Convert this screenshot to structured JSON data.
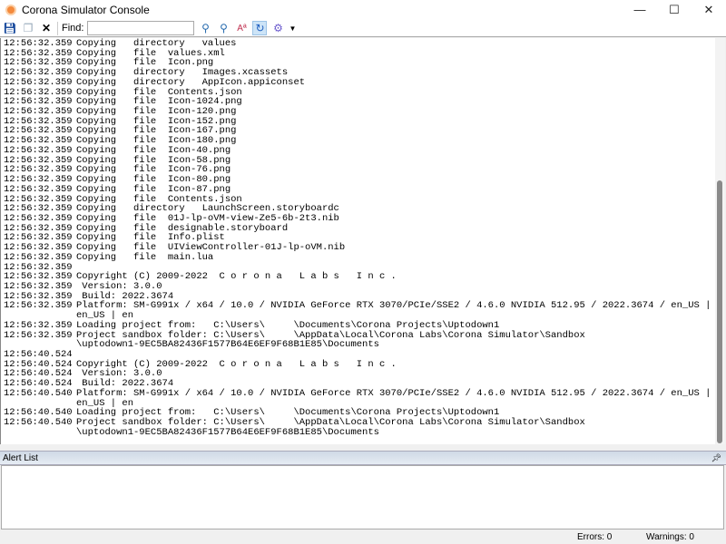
{
  "window": {
    "title": "Corona Simulator Console",
    "minimize": "—",
    "maximize": "☐",
    "close": "✕"
  },
  "toolbar": {
    "find_label": "Find:",
    "find_value": "",
    "icons": [
      "save-icon",
      "copy-icon",
      "clear-icon",
      "find-next-icon",
      "find-previous-icon",
      "match-case-icon",
      "wrap-icon",
      "settings-icon"
    ]
  },
  "console": {
    "lines": [
      [
        "12:56:32.359",
        "Copying   directory   values"
      ],
      [
        "12:56:32.359",
        "Copying   file  values.xml"
      ],
      [
        "12:56:32.359",
        "Copying   file  Icon.png"
      ],
      [
        "12:56:32.359",
        "Copying   directory   Images.xcassets"
      ],
      [
        "12:56:32.359",
        "Copying   directory   AppIcon.appiconset"
      ],
      [
        "12:56:32.359",
        "Copying   file  Contents.json"
      ],
      [
        "12:56:32.359",
        "Copying   file  Icon-1024.png"
      ],
      [
        "12:56:32.359",
        "Copying   file  Icon-120.png"
      ],
      [
        "12:56:32.359",
        "Copying   file  Icon-152.png"
      ],
      [
        "12:56:32.359",
        "Copying   file  Icon-167.png"
      ],
      [
        "12:56:32.359",
        "Copying   file  Icon-180.png"
      ],
      [
        "12:56:32.359",
        "Copying   file  Icon-40.png"
      ],
      [
        "12:56:32.359",
        "Copying   file  Icon-58.png"
      ],
      [
        "12:56:32.359",
        "Copying   file  Icon-76.png"
      ],
      [
        "12:56:32.359",
        "Copying   file  Icon-80.png"
      ],
      [
        "12:56:32.359",
        "Copying   file  Icon-87.png"
      ],
      [
        "12:56:32.359",
        "Copying   file  Contents.json"
      ],
      [
        "12:56:32.359",
        "Copying   directory   LaunchScreen.storyboardc"
      ],
      [
        "12:56:32.359",
        "Copying   file  01J-lp-oVM-view-Ze5-6b-2t3.nib"
      ],
      [
        "12:56:32.359",
        "Copying   file  designable.storyboard"
      ],
      [
        "12:56:32.359",
        "Copying   file  Info.plist"
      ],
      [
        "12:56:32.359",
        "Copying   file  UIViewController-01J-lp-oVM.nib"
      ],
      [
        "12:56:32.359",
        "Copying   file  main.lua"
      ],
      [
        "12:56:32.359",
        ""
      ],
      [
        "12:56:32.359",
        "Copyright (C) 2009-2022  C o r o n a   L a b s   I n c ."
      ],
      [
        "12:56:32.359",
        " Version: 3.0.0"
      ],
      [
        "12:56:32.359",
        " Build: 2022.3674"
      ],
      [
        "12:56:32.359",
        "Platform: SM-G991x / x64 / 10.0 / NVIDIA GeForce RTX 3070/PCIe/SSE2 / 4.6.0 NVIDIA 512.95 / 2022.3674 / en_US | US |"
      ],
      [
        "",
        "en_US | en"
      ],
      [
        "12:56:32.359",
        "Loading project from:   C:\\Users\\     \\Documents\\Corona Projects\\Uptodown1"
      ],
      [
        "12:56:32.359",
        "Project sandbox folder: C:\\Users\\     \\AppData\\Local\\Corona Labs\\Corona Simulator\\Sandbox"
      ],
      [
        "",
        "\\uptodown1-9EC5BA82436F1577B64E6EF9F68B1E85\\Documents"
      ],
      [
        "12:56:40.524",
        ""
      ],
      [
        "12:56:40.524",
        "Copyright (C) 2009-2022  C o r o n a   L a b s   I n c ."
      ],
      [
        "12:56:40.524",
        " Version: 3.0.0"
      ],
      [
        "12:56:40.524",
        " Build: 2022.3674"
      ],
      [
        "12:56:40.540",
        "Platform: SM-G991x / x64 / 10.0 / NVIDIA GeForce RTX 3070/PCIe/SSE2 / 4.6.0 NVIDIA 512.95 / 2022.3674 / en_US | US |"
      ],
      [
        "",
        "en_US | en"
      ],
      [
        "12:56:40.540",
        "Loading project from:   C:\\Users\\     \\Documents\\Corona Projects\\Uptodown1"
      ],
      [
        "12:56:40.540",
        "Project sandbox folder: C:\\Users\\     \\AppData\\Local\\Corona Labs\\Corona Simulator\\Sandbox"
      ],
      [
        "",
        "\\uptodown1-9EC5BA82436F1577B64E6EF9F68B1E85\\Documents"
      ]
    ]
  },
  "alert_list": {
    "title": "Alert List",
    "pin_icon": "pin-icon"
  },
  "status": {
    "errors": "Errors: 0",
    "warnings": "Warnings: 0"
  }
}
